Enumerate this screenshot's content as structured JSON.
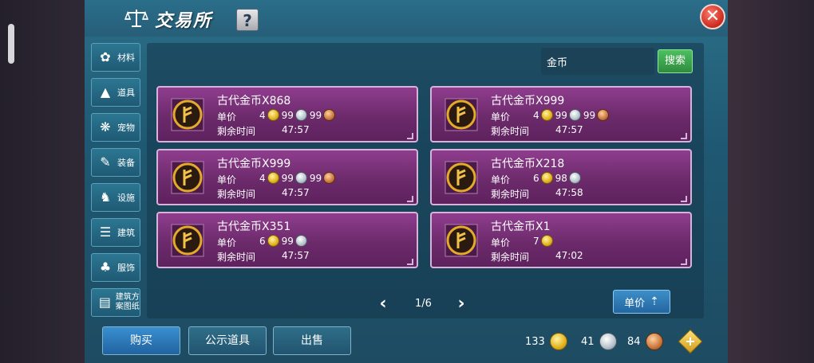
{
  "window": {
    "title": "交易所",
    "help_label": "?",
    "close_label": "✕"
  },
  "sidebar": {
    "items": [
      {
        "label": "材料",
        "icon": "materials-icon"
      },
      {
        "label": "道具",
        "icon": "item-icon"
      },
      {
        "label": "宠物",
        "icon": "pet-paw-icon"
      },
      {
        "label": "装备",
        "icon": "equipment-icon"
      },
      {
        "label": "设施",
        "icon": "facility-icon"
      },
      {
        "label": "建筑",
        "icon": "building-icon"
      },
      {
        "label": "服饰",
        "icon": "clothing-icon"
      },
      {
        "label": "建筑方案图纸",
        "icon": "blueprint-icon"
      }
    ]
  },
  "search": {
    "value": "金币",
    "button_label": "搜索"
  },
  "listings": [
    {
      "name": "古代金币X868",
      "price_label": "单价",
      "gold": "4",
      "silver": "99",
      "copper": "99",
      "time_label": "剩余时间",
      "time": "47:57"
    },
    {
      "name": "古代金币X999",
      "price_label": "单价",
      "gold": "4",
      "silver": "99",
      "copper": "99",
      "time_label": "剩余时间",
      "time": "47:57"
    },
    {
      "name": "古代金币X999",
      "price_label": "单价",
      "gold": "4",
      "silver": "99",
      "copper": "99",
      "time_label": "剩余时间",
      "time": "47:57"
    },
    {
      "name": "古代金币X218",
      "price_label": "单价",
      "gold": "6",
      "silver": "98",
      "copper": null,
      "time_label": "剩余时间",
      "time": "47:58"
    },
    {
      "name": "古代金币X351",
      "price_label": "单价",
      "gold": "6",
      "silver": "99",
      "copper": null,
      "time_label": "剩余时间",
      "time": "47:57"
    },
    {
      "name": "古代金币X1",
      "price_label": "单价",
      "gold": "7",
      "silver": null,
      "copper": null,
      "time_label": "剩余时间",
      "time": "47:02"
    }
  ],
  "pager": {
    "text": "1/6",
    "prev": "‹",
    "next": "›"
  },
  "sort": {
    "label": "单价",
    "arrow": "⇡"
  },
  "actions": {
    "buy": "购买",
    "public_items": "公示道具",
    "sell": "出售"
  },
  "wallet": {
    "gold": "133",
    "silver": "41",
    "copper": "84",
    "add": "+"
  },
  "colors": {
    "panel": "#1f5872",
    "listing": "#7a3079",
    "search_button": "#3ea64f",
    "buy_button": "#2a78bb",
    "close_button": "#d3352a"
  }
}
